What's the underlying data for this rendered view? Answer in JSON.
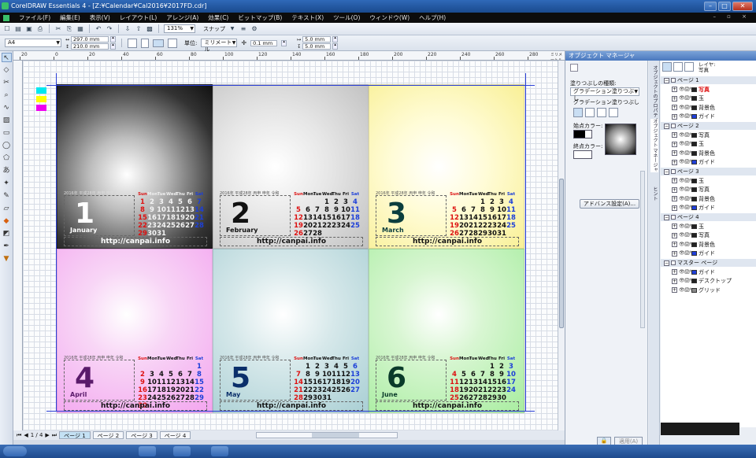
{
  "window": {
    "title": "CorelDRAW Essentials 4 - [Z:¥Calendar¥Cal2016¥2017FD.cdr]"
  },
  "menu": [
    "ファイル(F)",
    "編集(E)",
    "表示(V)",
    "レイアウト(L)",
    "アレンジ(A)",
    "効果(C)",
    "ビットマップ(B)",
    "テキスト(X)",
    "ツール(O)",
    "ウィンドウ(W)",
    "ヘルプ(H)"
  ],
  "toolbar": {
    "zoom": "131%",
    "snap": "スナップ"
  },
  "propbar": {
    "paper": "A4",
    "width": "297.0 mm",
    "height": "210.0 mm",
    "units_label": "単位:",
    "units": "ミリメートル",
    "nudge": "0.1 mm",
    "dup_x": "5.0 mm",
    "dup_y": "5.0 mm"
  },
  "ruler": {
    "top_ticks": [
      "20",
      "0",
      "20",
      "40",
      "60",
      "80",
      "100",
      "120",
      "140",
      "160",
      "180",
      "200",
      "220",
      "240",
      "260",
      "280"
    ],
    "unit": "ミリメートル"
  },
  "calendar": {
    "url": "http://canpai.info",
    "days_header": [
      "Sun",
      "Mon",
      "Tue",
      "Wed",
      "Thu",
      "Fri",
      "Sat"
    ],
    "months": [
      {
        "num": "1",
        "name": "January",
        "caption": "2016年 平成28年 丙申 申年 令和",
        "start": 0,
        "days": 31,
        "bg": "radial-gradient(circle at 45% 55%,#ffffff 0%,#bdbdbd 30%,#333 75%,#111 100%)",
        "numcolor": "#ffffff",
        "captioncolor": "#ddd"
      },
      {
        "num": "2",
        "name": "February",
        "caption": "2016年 平成28年 丙申 申年 令和",
        "start": 3,
        "days": 28,
        "bg": "radial-gradient(circle at 40% 50%,#ffffff 0%,#e6e6e6 45%,#c2c2c2 100%)",
        "numcolor": "#111111",
        "captioncolor": "#555"
      },
      {
        "num": "3",
        "name": "March",
        "caption": "2016年 平成28年 丙申 申年 令和",
        "start": 3,
        "days": 31,
        "bg": "radial-gradient(circle at 45% 50%,#ffffff 0%,#fffcd8 40%,#f9f096 100%)",
        "numcolor": "#0b3e3e",
        "captioncolor": "#555"
      },
      {
        "num": "4",
        "name": "April",
        "caption": "2016年 平成28年 丙申 申年 令和",
        "start": 6,
        "days": 30,
        "bg": "radial-gradient(circle at 45% 40%,#ffffff 0%,#f8d6f6 35%,#f3a4ef 100%)",
        "numcolor": "#5a1a6a",
        "captioncolor": "#555"
      },
      {
        "num": "5",
        "name": "May",
        "caption": "2016年 平成28年 丙申 申年 令和",
        "start": 1,
        "days": 31,
        "bg": "radial-gradient(circle at 45% 40%,#ffffff 0%,#d6e8ea 40%,#a9cfd4 100%)",
        "numcolor": "#0b2f6a",
        "captioncolor": "#555"
      },
      {
        "num": "6",
        "name": "June",
        "caption": "2016年 平成28年 丙申 申年 令和",
        "start": 4,
        "days": 30,
        "bg": "radial-gradient(circle at 45% 40%,#ffffff 0%,#d8f6d2 35%,#a8eda0 100%)",
        "numcolor": "#0a3a2a",
        "captioncolor": "#555"
      }
    ]
  },
  "objmgr": {
    "title": "オブジェクト マネージャ",
    "fill_type_label": "塗りつぶしの種類:",
    "fill_type": "グラデーション塗りつぶし",
    "grad_label": "グラデーション塗りつぶし",
    "start_label": "始点カラー:",
    "end_label": "終点カラー:",
    "advanced": "アドバンス設定(A)...",
    "apply": "適用(A)",
    "layer_label": "レイヤ:",
    "layer_value": "写真",
    "tabs": [
      "オブジェクトのプロパティ",
      "オブジェクト マネージャ",
      "ヒント"
    ],
    "tree": [
      {
        "type": "page",
        "label": "ページ 1"
      },
      {
        "type": "layer",
        "label": "写真",
        "color": "#222",
        "active": true
      },
      {
        "type": "layer",
        "label": "玉",
        "color": "#222"
      },
      {
        "type": "layer",
        "label": "背景色",
        "color": "#222"
      },
      {
        "type": "layer",
        "label": "ガイド",
        "color": "#1f3fd8"
      },
      {
        "type": "page",
        "label": "ページ 2"
      },
      {
        "type": "layer",
        "label": "写真",
        "color": "#222"
      },
      {
        "type": "layer",
        "label": "玉",
        "color": "#222"
      },
      {
        "type": "layer",
        "label": "背景色",
        "color": "#222"
      },
      {
        "type": "layer",
        "label": "ガイド",
        "color": "#1f3fd8"
      },
      {
        "type": "page",
        "label": "ページ 3"
      },
      {
        "type": "layer",
        "label": "玉",
        "color": "#222"
      },
      {
        "type": "layer",
        "label": "写真",
        "color": "#222"
      },
      {
        "type": "layer",
        "label": "背景色",
        "color": "#222"
      },
      {
        "type": "layer",
        "label": "ガイド",
        "color": "#1f3fd8"
      },
      {
        "type": "page",
        "label": "ページ 4"
      },
      {
        "type": "layer",
        "label": "玉",
        "color": "#222"
      },
      {
        "type": "layer",
        "label": "写真",
        "color": "#222"
      },
      {
        "type": "layer",
        "label": "背景色",
        "color": "#222"
      },
      {
        "type": "layer",
        "label": "ガイド",
        "color": "#1f3fd8"
      },
      {
        "type": "page",
        "label": "マスター ページ"
      },
      {
        "type": "layer",
        "label": "ガイド",
        "color": "#1f3fd8"
      },
      {
        "type": "layer",
        "label": "デスクトップ",
        "color": "#222"
      },
      {
        "type": "layer",
        "label": "グリッド",
        "color": "#888"
      }
    ]
  },
  "pagebar": {
    "counter": "1 / 4",
    "tabs": [
      "ページ 1",
      "ページ 2",
      "ページ 3",
      "ページ 4"
    ]
  }
}
